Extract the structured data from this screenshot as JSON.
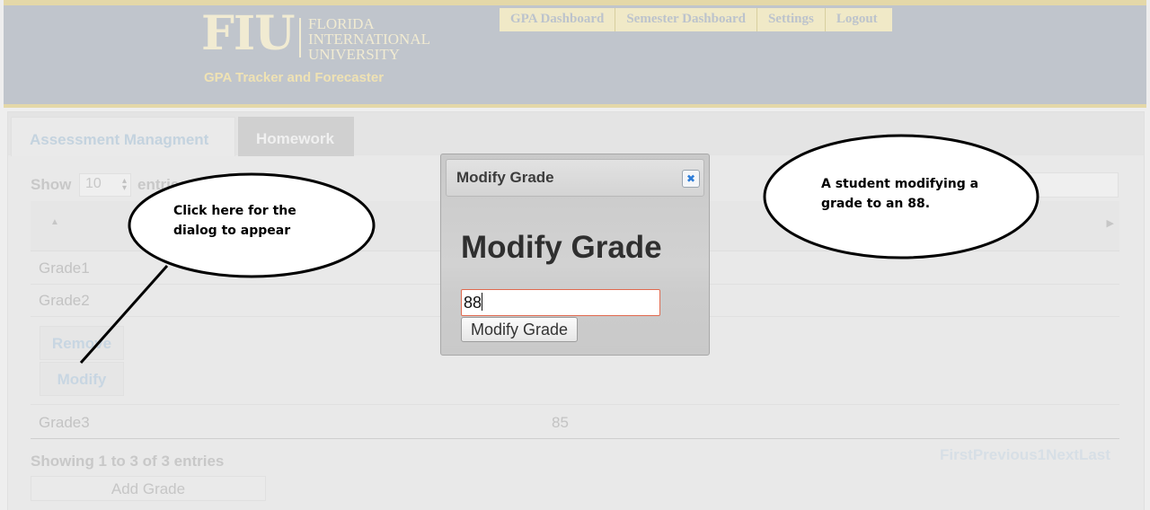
{
  "header": {
    "logo_mark": "FIU",
    "logo_line1": "FLORIDA",
    "logo_line2": "INTERNATIONAL",
    "logo_line3": "UNIVERSITY",
    "subtitle": "GPA Tracker and Forecaster"
  },
  "nav": {
    "items": [
      {
        "label": "GPA Dashboard"
      },
      {
        "label": "Semester Dashboard"
      },
      {
        "label": "Settings"
      },
      {
        "label": "Logout"
      }
    ]
  },
  "tabs": [
    {
      "label": "Assessment Managment"
    },
    {
      "label": "Homework",
      "active": true
    }
  ],
  "table": {
    "show_label": "Show",
    "page_size": "10",
    "entries_label": "entries",
    "rows": [
      {
        "name": "Grade1",
        "value": ""
      },
      {
        "name": "Grade2",
        "value": ""
      },
      {
        "name": "Grade3",
        "value": "85"
      }
    ],
    "remove_label": "Remove",
    "modify_label": "Modify",
    "info": "Showing 1 to 3 of 3 entries",
    "pager": "FirstPrevious1NextLast",
    "add_label": "Add Grade"
  },
  "dialog": {
    "title": "Modify Grade",
    "heading": "Modify Grade",
    "input_value": "88",
    "button_label": "Modify Grade",
    "close_icon": "close-icon"
  },
  "callouts": {
    "left": {
      "line1": "Click here for the",
      "line2": "dialog to appear"
    },
    "right": {
      "line1": "A student modifying a",
      "line2": "grade to an 88."
    }
  },
  "colors": {
    "header_bg": "#c0c5cc",
    "accent_cream": "#e4d8a8",
    "input_border": "#e06a4f",
    "close_icon": "#2e7dd8"
  }
}
